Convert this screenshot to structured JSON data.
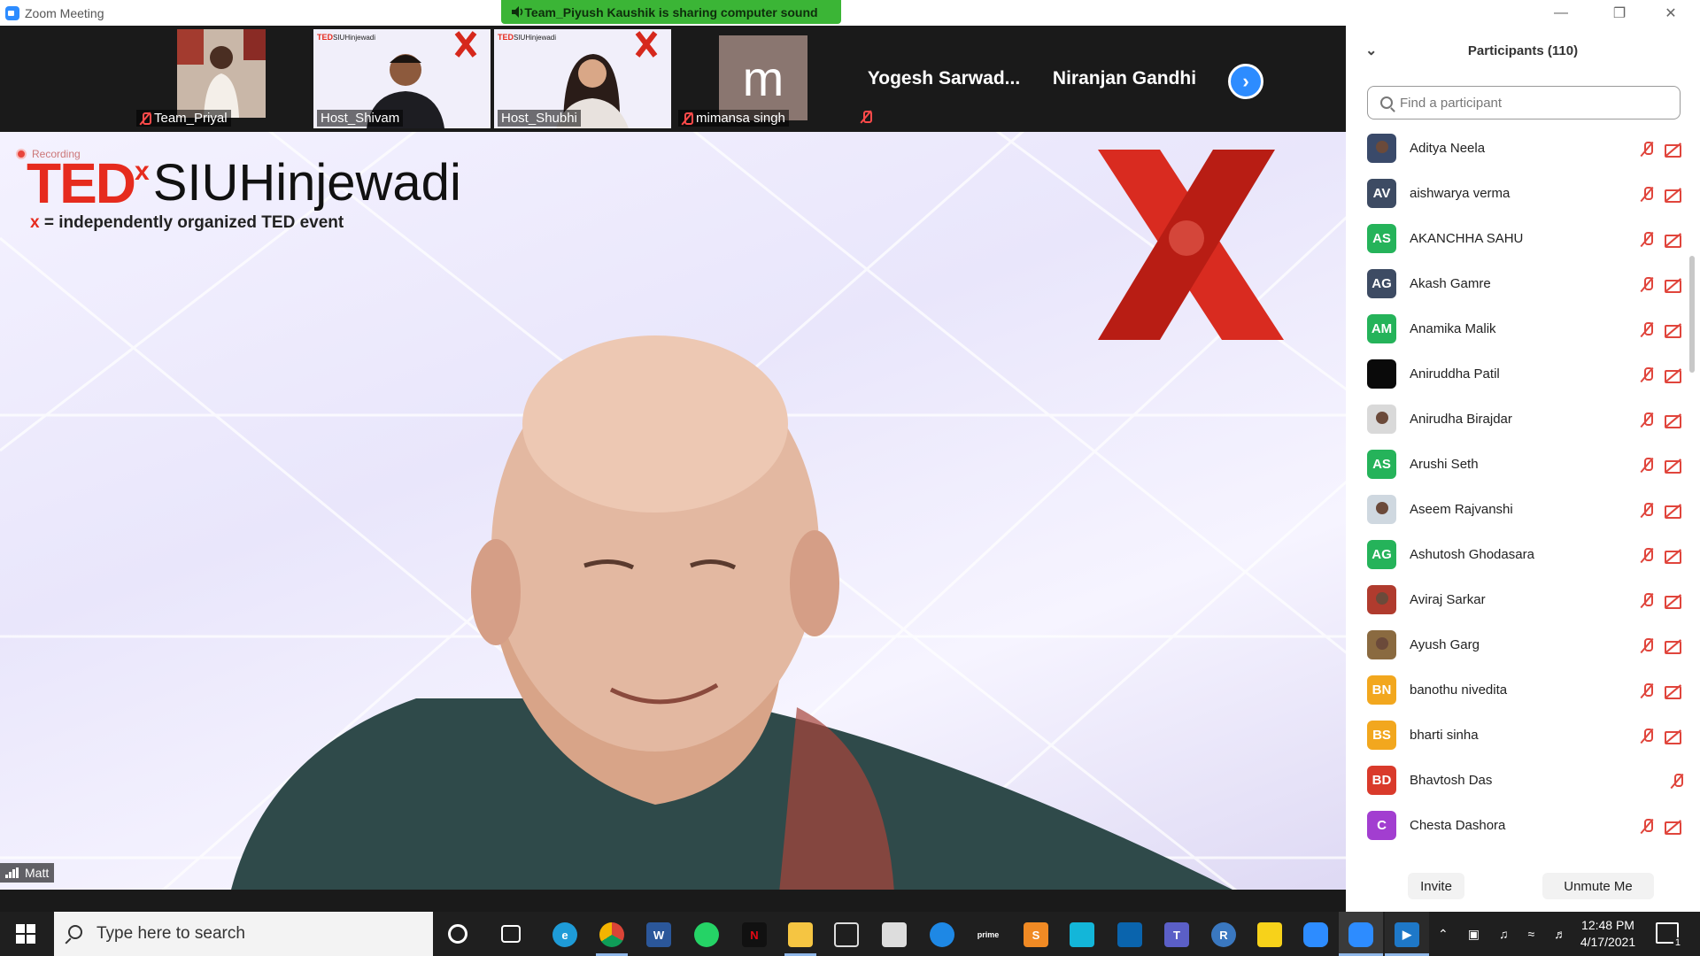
{
  "window": {
    "title": "Zoom Meeting",
    "share_banner": "Team_Piyush Kaushik is sharing computer sound"
  },
  "thumbnails": [
    {
      "name": "Team_Priyal",
      "muted": true
    },
    {
      "name": "Host_Shivam",
      "muted": false
    },
    {
      "name": "Host_Shubhi",
      "muted": false
    },
    {
      "name": "mimansa singh",
      "muted": true,
      "avatar_letter": "m"
    }
  ],
  "name_tiles": [
    {
      "name": "Yogesh  Sarwad..."
    },
    {
      "name": "Niranjan Gandhi"
    }
  ],
  "main": {
    "recording_label": "Recording",
    "logo_ted": "TED",
    "logo_x": "x",
    "logo_event": "SIUHinjewadi",
    "logo_tagline_x": "x",
    "logo_tagline": " = independently organized TED event",
    "presenter_name": "Matt"
  },
  "participants_panel": {
    "title": "Participants (110)",
    "search_placeholder": "Find a participant",
    "invite_label": "Invite",
    "unmute_label": "Unmute Me",
    "participants": [
      {
        "name": "Aditya Neela",
        "initials": "",
        "color": "#3a4a6a",
        "photo": true,
        "cam_off": true
      },
      {
        "name": "aishwarya verma",
        "initials": "AV",
        "color": "#3d4b63",
        "cam_off": true
      },
      {
        "name": "AKANCHHA SAHU",
        "initials": "AS",
        "color": "#25b35a",
        "cam_off": true
      },
      {
        "name": "Akash Gamre",
        "initials": "AG",
        "color": "#3d4b63",
        "cam_off": true
      },
      {
        "name": "Anamika Malik",
        "initials": "AM",
        "color": "#25b35a",
        "cam_off": true
      },
      {
        "name": "Aniruddha Patil",
        "initials": "",
        "color": "#0a0a0a",
        "cam_off": true
      },
      {
        "name": "Anirudha Birajdar",
        "initials": "",
        "color": "#d9d9d9",
        "photo": true,
        "cam_off": true
      },
      {
        "name": "Arushi Seth",
        "initials": "AS",
        "color": "#25b35a",
        "cam_off": true
      },
      {
        "name": "Aseem Rajvanshi",
        "initials": "",
        "color": "#cfd8e0",
        "photo": true,
        "cam_off": true
      },
      {
        "name": "Ashutosh Ghodasara",
        "initials": "AG",
        "color": "#25b35a",
        "cam_off": true
      },
      {
        "name": "Aviraj Sarkar",
        "initials": "",
        "color": "#b03b2e",
        "photo": true,
        "cam_off": true
      },
      {
        "name": "Ayush Garg",
        "initials": "",
        "color": "#8a6a40",
        "photo": true,
        "cam_off": true
      },
      {
        "name": "banothu nivedita",
        "initials": "BN",
        "color": "#f2a71e",
        "cam_off": true
      },
      {
        "name": "bharti sinha",
        "initials": "BS",
        "color": "#f2a71e",
        "cam_off": true
      },
      {
        "name": "Bhavtosh Das",
        "initials": "BD",
        "color": "#d93a2b",
        "cam_off": false
      },
      {
        "name": "Chesta Dashora",
        "initials": "C",
        "color": "#a23ed0",
        "cam_off": true
      }
    ]
  },
  "taskbar": {
    "search_placeholder": "Type here to search",
    "time": "12:48 PM",
    "date": "4/17/2021",
    "notification_count": "1"
  }
}
